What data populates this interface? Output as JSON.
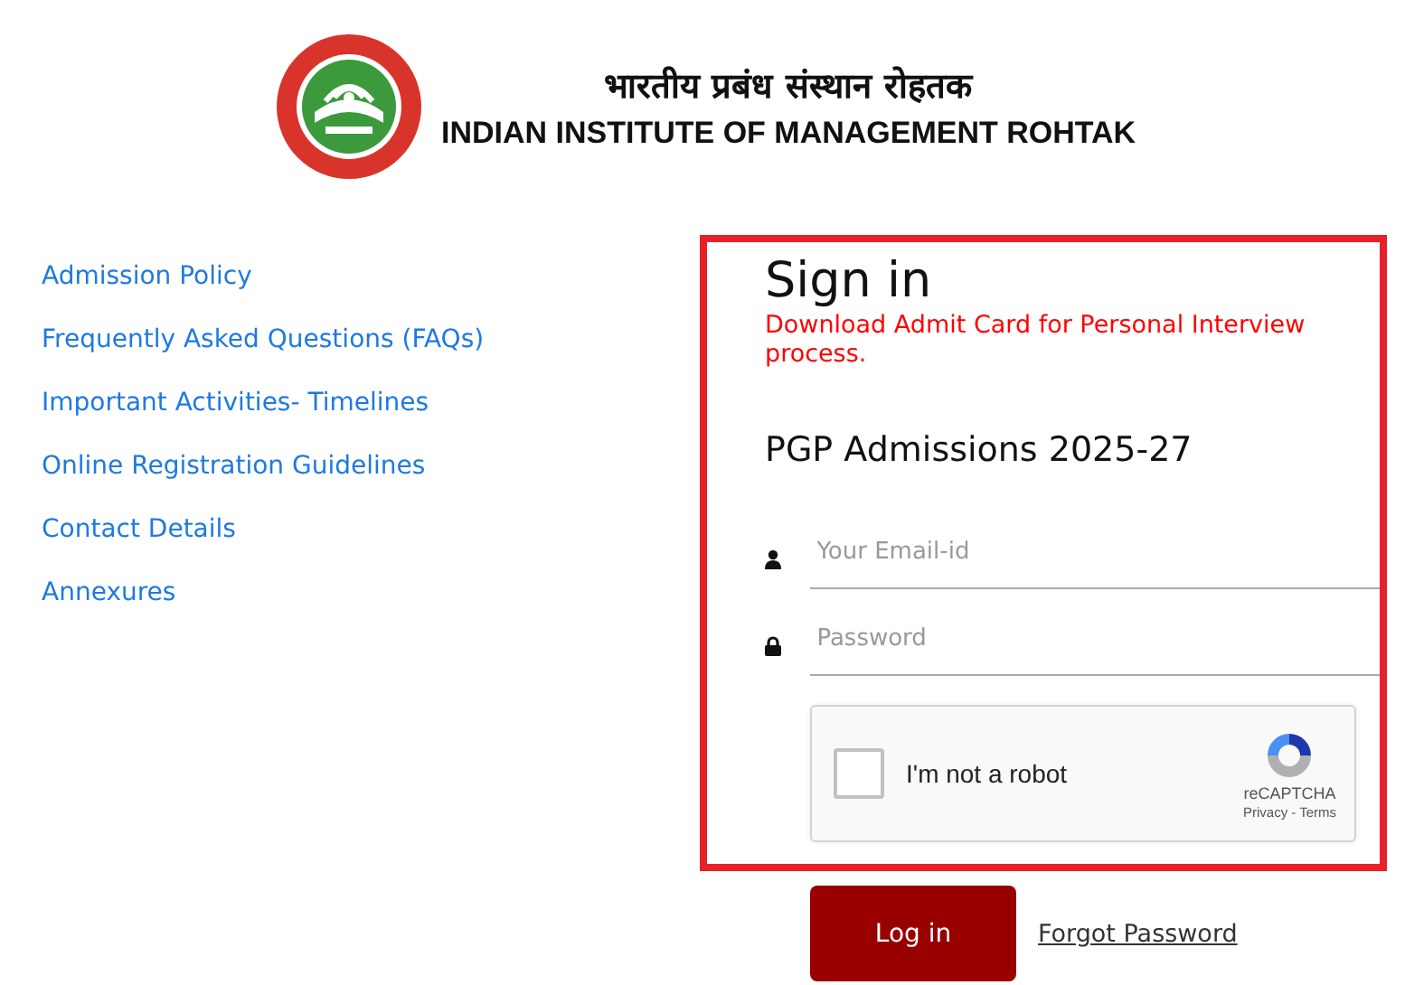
{
  "header": {
    "title_hindi": "भारतीय प्रबंध संस्थान रोहतक",
    "title": "INDIAN INSTITUTE OF MANAGEMENT ROHTAK"
  },
  "links": [
    "Admission Policy",
    "Frequently Asked Questions (FAQs)",
    "Important Activities- Timelines",
    "Online Registration Guidelines",
    "Contact Details",
    "Annexures"
  ],
  "signin": {
    "heading": "Sign in",
    "notice": "Download Admit Card for Personal Interview process.",
    "subheading": "PGP Admissions 2025-27",
    "fields": [
      {
        "kind": "user",
        "placeholder": "Your Email-id"
      },
      {
        "kind": "lock",
        "placeholder": "Password"
      }
    ],
    "captcha": {
      "label": "I'm not a robot",
      "checked": false,
      "brand": "reCAPTCHA",
      "privacy": "Privacy",
      "separator": "-",
      "terms": "Terms"
    }
  },
  "login_button": "Log in",
  "forgot_link": "Forgot Password"
}
